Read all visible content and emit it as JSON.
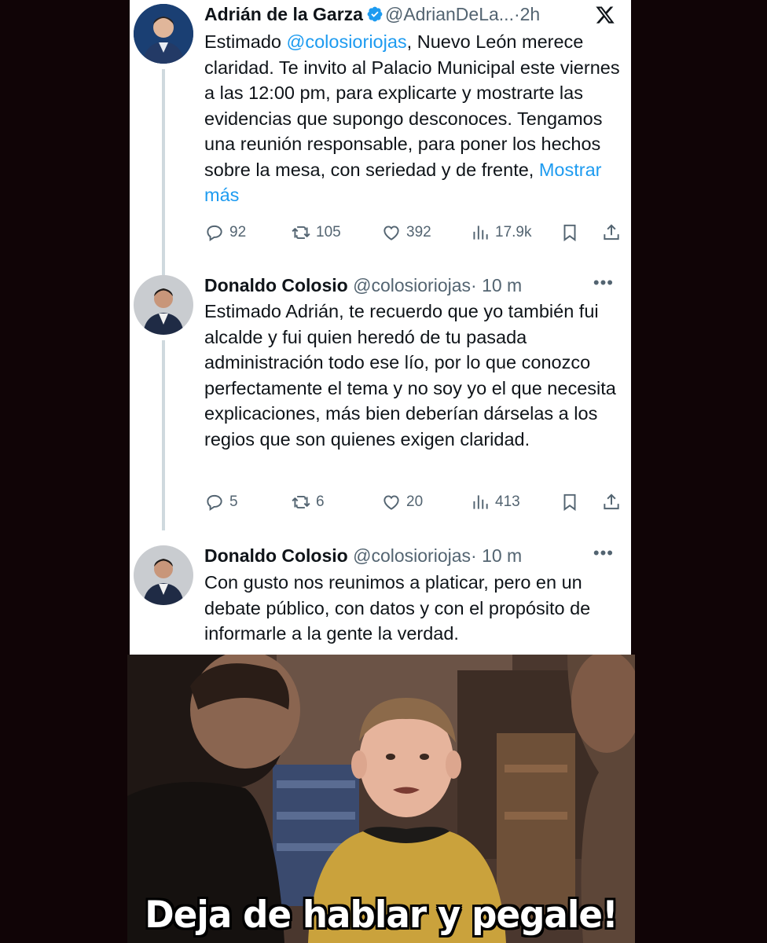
{
  "tweets": [
    {
      "name": "Adrián de la Garza",
      "handle": "@AdrianDeLa...",
      "sep": "·",
      "time": "2h",
      "text_before": "Estimado ",
      "mention": "@colosioriojas",
      "text_after": ", Nuevo León merece claridad. Te invito al Palacio Municipal este viernes a las 12:00 pm, para explicarte y mostrarte las evidencias que supongo desconoces. Tengamos una reunión responsable, para poner los hechos sobre la mesa, con seriedad y de frente, ",
      "show_more": "Mostrar más",
      "replies": "92",
      "retweets": "105",
      "likes": "392",
      "views": "17.9k"
    },
    {
      "name": "Donaldo Colosio",
      "handle": "@colosioriojas",
      "sep": "·",
      "time": "10 m",
      "text": "Estimado Adrián, te recuerdo que yo también fui alcalde y fui quien heredó de tu pasada administración todo ese lío, por lo que conozco perfectamente el tema y no soy yo el que necesita explicaciones, más bien deberían dárselas a los regios que son quienes exigen claridad.",
      "replies": "5",
      "retweets": "6",
      "likes": "20",
      "views": "413"
    },
    {
      "name": "Donaldo Colosio",
      "handle": "@colosioriojas",
      "sep": "·",
      "time": "10 m",
      "text": "Con gusto nos reunimos a platicar, pero en un debate público, con datos y con el propósito de informarle a la gente la verdad."
    }
  ],
  "meme": {
    "caption": "Deja de hablar y pegale!"
  },
  "icons": {
    "verified": "verified-badge-icon",
    "platform": "x-logo-icon",
    "more": "more-dots-icon",
    "reply": "reply-icon",
    "retweet": "retweet-icon",
    "like": "heart-icon",
    "views": "views-icon",
    "bookmark": "bookmark-icon",
    "share": "share-icon"
  },
  "colors": {
    "accent": "#1d9bf0",
    "text": "#0f1419",
    "muted": "#536471",
    "background": "#100406"
  }
}
